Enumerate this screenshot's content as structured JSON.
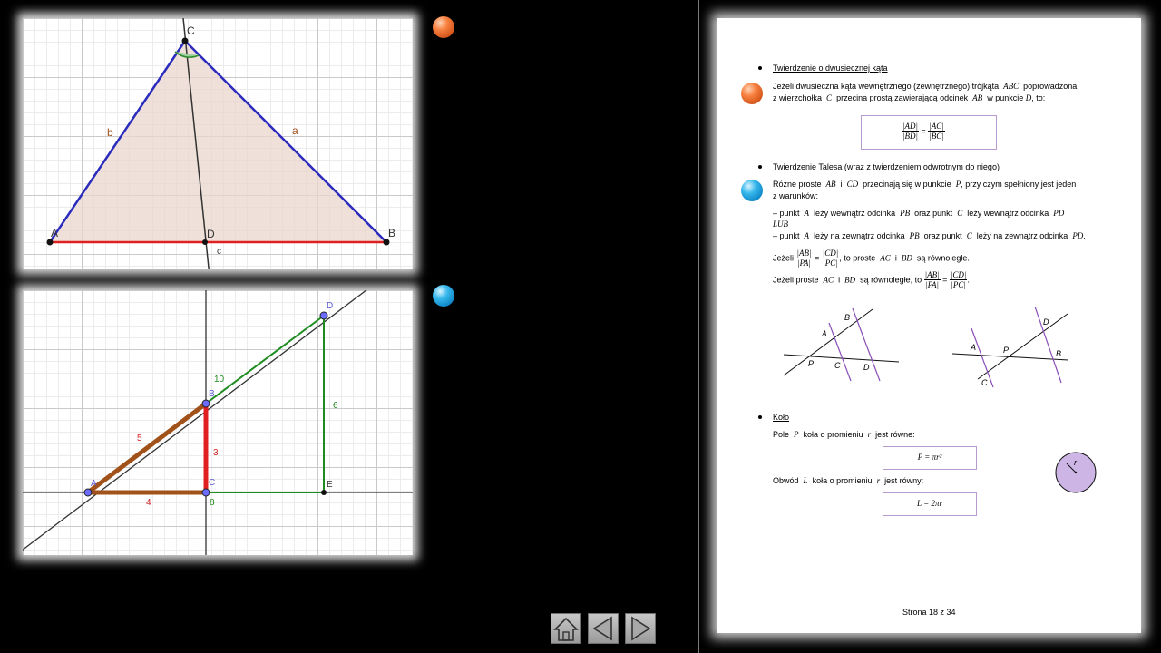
{
  "top_figure": {
    "points": {
      "A": "A",
      "B": "B",
      "C": "C",
      "D": "D"
    },
    "sides": {
      "a": "a",
      "b": "b",
      "c": "c"
    }
  },
  "bottom_figure": {
    "points": {
      "A": "A",
      "B": "B",
      "C": "C",
      "D": "D",
      "E": "E"
    },
    "lengths": {
      "AB": "5",
      "BC": "3",
      "AC": "4",
      "BD": "10",
      "DE": "6",
      "CE": "8"
    }
  },
  "page": {
    "section1": {
      "heading": "Twierdzenie o dwusiecznej kąta",
      "line1_a": "Jeżeli dwusieczna kąta wewnętrznego (zewnętrznego) trójkąta",
      "line1_abc": "ABC",
      "line1_b": "poprowadzona",
      "line2_a": "z wierzchołka",
      "line2_c": "C",
      "line2_b": "przecina prostą zawierającą odcinek",
      "line2_ab": "AB",
      "line2_c2": "w punkcie",
      "line2_d": "D",
      "line2_end": ", to:",
      "formula": {
        "num1": "|AD|",
        "den1": "|BD|",
        "eq": "=",
        "num2": "|AC|",
        "den2": "|BC|"
      }
    },
    "section2": {
      "heading": "Twierdzenie Talesa (wraz z twierdzeniem odwrotnym do niego)",
      "l1_a": "Różne proste",
      "l1_ab": "AB",
      "l1_i": "i",
      "l1_cd": "CD",
      "l1_b": "przecinają się w punkcie",
      "l1_p": "P",
      "l1_c": ", przy czym spełniony jest jeden",
      "l2": "z warunków:",
      "c1_a": "– punkt",
      "c1_A": "A",
      "c1_b": "leży wewnątrz odcinka",
      "c1_pb": "PB",
      "c1_c": "oraz  punkt",
      "c1_C": "C",
      "c1_d": "leży wewnątrz odcinka",
      "c1_pd": "PD",
      "lub": "LUB",
      "c2_a": "– punkt",
      "c2_A": "A",
      "c2_b": "leży na zewnątrz odcinka",
      "c2_pb": "PB",
      "c2_c": "oraz  punkt",
      "c2_C": "C",
      "c2_d": "leży na zewnątrz odcinka",
      "c2_pd": "PD",
      "c2_end": ".",
      "if1_a": "Jeżeli",
      "if1_f1n": "|AB|",
      "if1_f1d": "|PA|",
      "if1_eq": "=",
      "if1_f2n": "|CD|",
      "if1_f2d": "|PC|",
      "if1_b": ", to proste",
      "if1_ac": "AC",
      "if1_i": "i",
      "if1_bd": "BD",
      "if1_c": "są równoległe.",
      "if2_a": "Jeżeli proste",
      "if2_ac": "AC",
      "if2_i": "i",
      "if2_bd": "BD",
      "if2_b": "są równoległe, to",
      "if2_f1n": "|AB|",
      "if2_f1d": "|PA|",
      "if2_eq": "=",
      "if2_f2n": "|CD|",
      "if2_f2d": "|PC|",
      "if2_end": ".",
      "fig1": {
        "A": "A",
        "B": "B",
        "P": "P",
        "C": "C",
        "D": "D"
      },
      "fig2": {
        "A": "A",
        "P": "P",
        "D": "D",
        "B": "B",
        "C": "C"
      }
    },
    "section3": {
      "heading": "Koło",
      "area_a": "Pole",
      "area_P": "P",
      "area_b": "koła o promieniu",
      "area_r": "r",
      "area_c": "jest równe:",
      "area_formula": "P = πr²",
      "circ_a": "Obwód",
      "circ_L": "L",
      "circ_b": "koła o promieniu",
      "circ_r": "r",
      "circ_c": "jest równy:",
      "circ_formula": "L = 2πr",
      "circle_label": "r"
    },
    "footer": "Strona 18 z 34"
  },
  "nav": {
    "home": "home-icon",
    "prev": "triangle-left-icon",
    "next": "triangle-right-icon"
  },
  "colors": {
    "orange": "#f07a38",
    "blue": "#27aee6",
    "triangle_blue": "#2b2bbd",
    "red": "#e02020",
    "green": "#1e8c1e",
    "brown": "#a0521a",
    "lilac": "#cdb6e6"
  }
}
